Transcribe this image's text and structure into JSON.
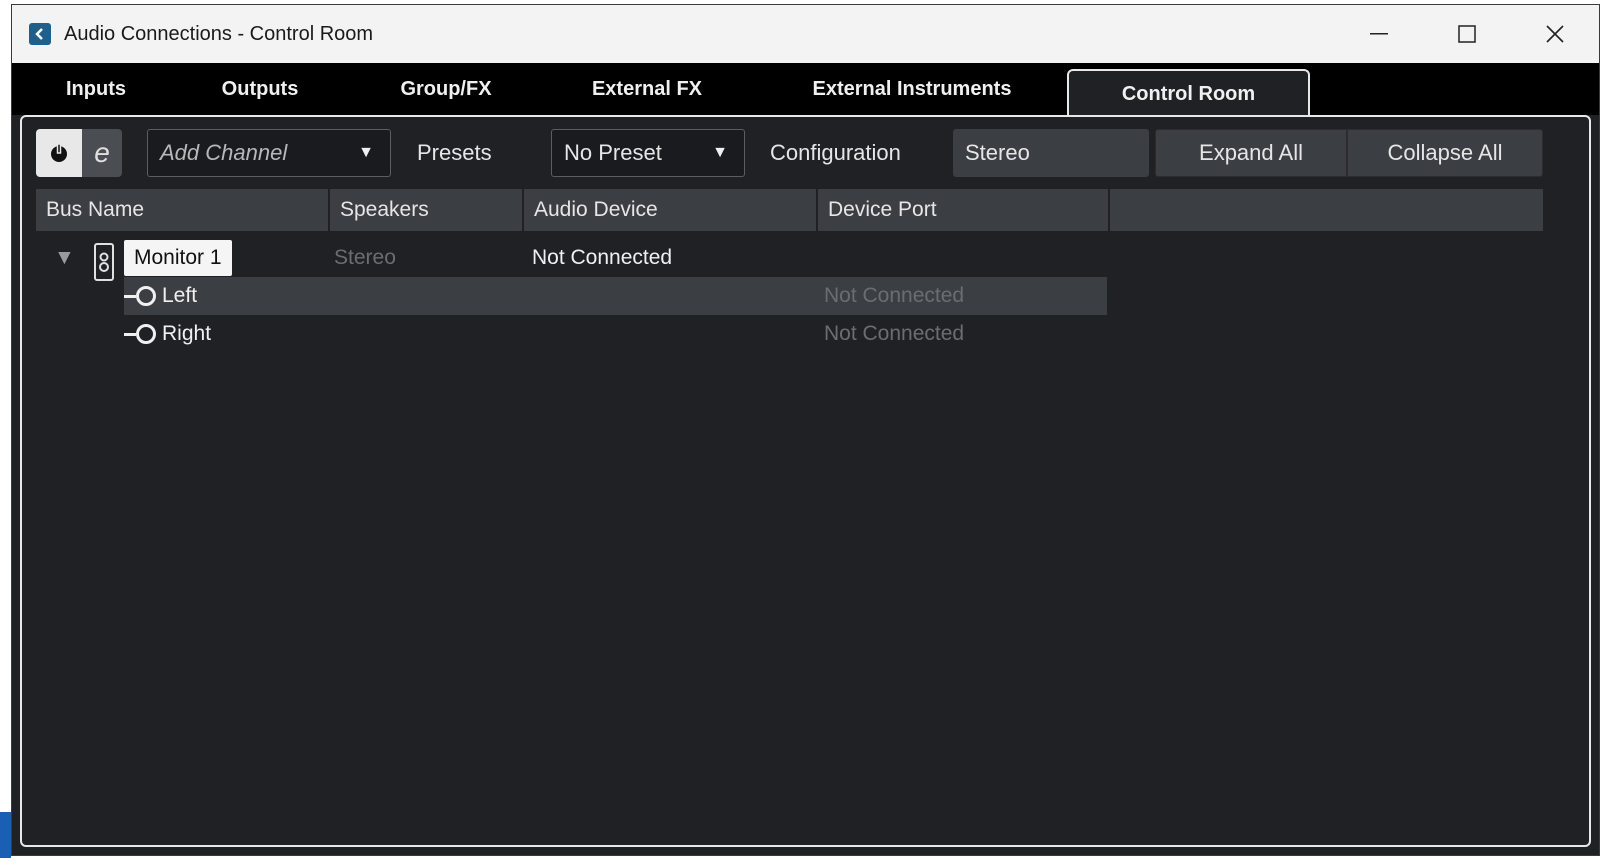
{
  "window": {
    "title": "Audio Connections - Control Room",
    "minimize_label": "—",
    "maximize_label": "☐",
    "close_label": "✕"
  },
  "tabs": [
    {
      "label": "Inputs",
      "active": false
    },
    {
      "label": "Outputs",
      "active": false
    },
    {
      "label": "Group/FX",
      "active": false
    },
    {
      "label": "External FX",
      "active": false
    },
    {
      "label": "External Instruments",
      "active": false
    },
    {
      "label": "Control Room",
      "active": true
    }
  ],
  "toolbar": {
    "add_channel_label": "Add Channel",
    "presets_label": "Presets",
    "preset_value": "No Preset",
    "configuration_label": "Configuration",
    "configuration_value": "Stereo",
    "expand_all_label": "Expand All",
    "collapse_all_label": "Collapse All",
    "edit_glyph": "e"
  },
  "columns": [
    "Bus Name",
    "Speakers",
    "Audio Device",
    "Device Port"
  ],
  "bus": {
    "name": "Monitor 1",
    "speakers": "Stereo",
    "audio_device": "Not Connected",
    "ports": [
      {
        "name": "Left",
        "device_port": "Not Connected",
        "selected": true
      },
      {
        "name": "Right",
        "device_port": "Not Connected",
        "selected": false
      }
    ]
  },
  "icons": {
    "app": "cubase-app-icon",
    "power": "power-icon",
    "edit": "edit-icon",
    "expander": "expand-triangle-icon",
    "bus": "speaker-icon",
    "port": "output-port-icon"
  },
  "colors": {
    "background": "#202124",
    "panel_header": "#3b3e43",
    "tab_bar": "#000000",
    "text": "#e6e6e6",
    "dim_text": "#6a6d72"
  }
}
